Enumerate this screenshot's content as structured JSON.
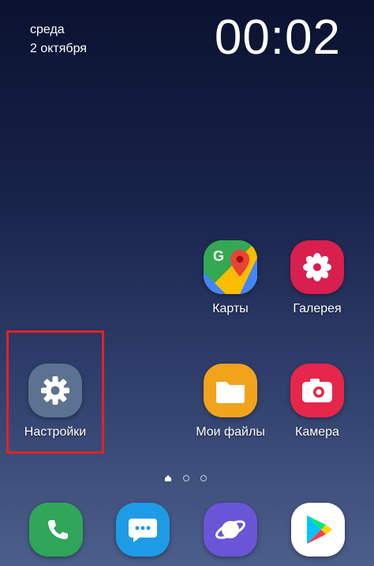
{
  "status": {
    "day": "среда",
    "date": "2 октября",
    "time": "00:02"
  },
  "apps": {
    "maps": {
      "label": "Карты"
    },
    "gallery": {
      "label": "Галерея"
    },
    "settings": {
      "label": "Настройки"
    },
    "files": {
      "label": "Мои файлы"
    },
    "camera": {
      "label": "Камера"
    }
  },
  "page_indicator": {
    "pages": 2,
    "current": "home"
  },
  "dock": {
    "items": [
      {
        "name": "phone",
        "icon": "phone-icon"
      },
      {
        "name": "messages",
        "icon": "messages-icon"
      },
      {
        "name": "internet",
        "icon": "planet-icon"
      },
      {
        "name": "play-store",
        "icon": "play-store-icon"
      }
    ]
  },
  "colors": {
    "highlight": "#e32222",
    "settings_bg": "#5b7391",
    "files_bg": "#f2a31c",
    "camera_bg": "#e6264a",
    "gallery_bg": "#d81f4e",
    "phone_bg": "#2fa65a",
    "messages_bg": "#1e9be7",
    "internet_bg": "#6a55d6"
  }
}
